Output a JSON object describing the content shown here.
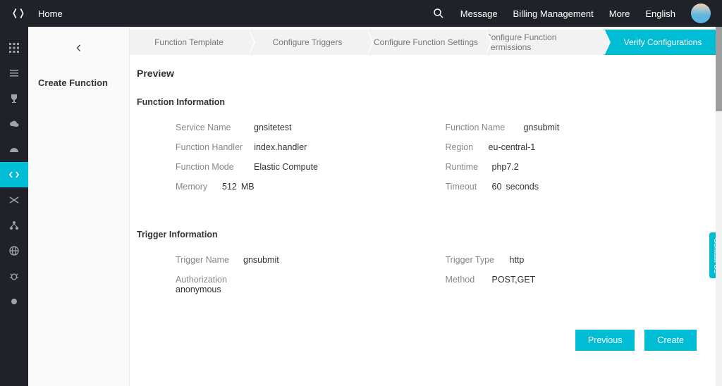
{
  "topbar": {
    "home": "Home",
    "links": [
      "Message",
      "Billing Management",
      "More",
      "English"
    ]
  },
  "subpanel": {
    "title": "Create Function"
  },
  "wizard": {
    "steps": [
      "Function Template",
      "Configure Triggers",
      "Configure Function Settings",
      "Configure Function Permissions",
      "Verify Configurations"
    ],
    "active_index": 4
  },
  "preview": {
    "title": "Preview",
    "function_section": "Function Information",
    "trigger_section": "Trigger Information",
    "fields": {
      "service_name_label": "Service Name",
      "service_name": "gnsitetest",
      "function_handler_label": "Function Handler",
      "function_handler": "index.handler",
      "function_mode_label": "Function Mode",
      "function_mode": "Elastic Compute",
      "memory_label": "Memory",
      "memory_value": "512",
      "memory_unit": "MB",
      "function_name_label": "Function Name",
      "function_name": "gnsubmit",
      "region_label": "Region",
      "region": "eu-central-1",
      "runtime_label": "Runtime",
      "runtime": "php7.2",
      "timeout_label": "Timeout",
      "timeout_value": "60",
      "timeout_unit": "seconds",
      "trigger_name_label": "Trigger Name",
      "trigger_name": "gnsubmit",
      "authorization_label": "Authorization",
      "authorization": "anonymous",
      "trigger_type_label": "Trigger Type",
      "trigger_type": "http",
      "method_label": "Method",
      "method": "POST,GET"
    }
  },
  "actions": {
    "previous": "Previous",
    "create": "Create"
  },
  "contact": "Contact Us"
}
